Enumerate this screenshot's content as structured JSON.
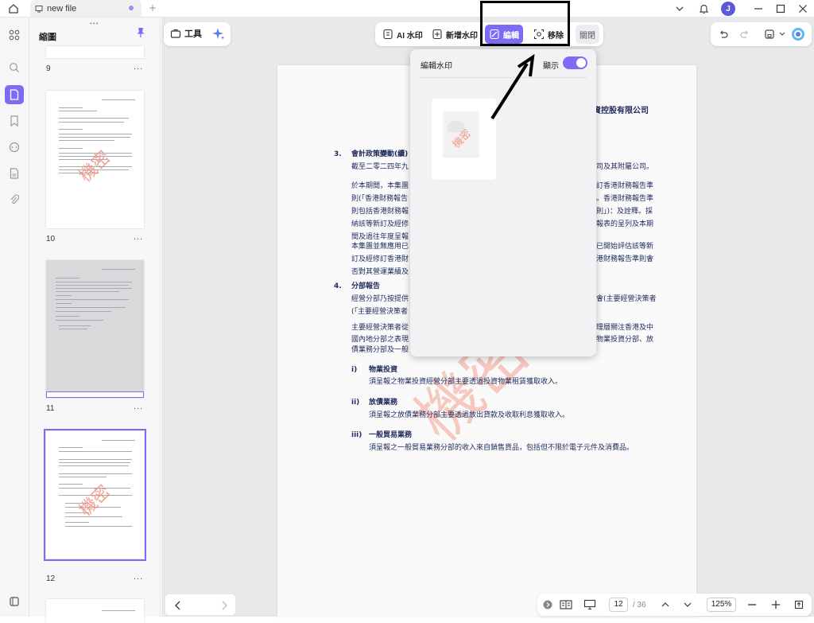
{
  "tab": {
    "title": "new file"
  },
  "user": {
    "initial": "J"
  },
  "panel": {
    "title": "縮圖"
  },
  "thumbs": [
    {
      "num": "9",
      "more": "..."
    },
    {
      "num": "10",
      "more": "...",
      "watermark": "機密"
    },
    {
      "num": "11",
      "more": "..."
    },
    {
      "num": "12",
      "more": "...",
      "watermark": "機密"
    }
  ],
  "toolbar": {
    "tools_label": "工具"
  },
  "watermark_bar": {
    "ai_label": "AI 水印",
    "add_label": "新增水印",
    "edit_label": "編輯",
    "remove_label": "移除",
    "close_label": "關閉"
  },
  "popup": {
    "title": "編輯水印",
    "show_label": "顯示",
    "show_on": true,
    "thumb_watermark": "機密"
  },
  "document": {
    "company": "投資控股有限公司",
    "s3_num": "3.",
    "s3_title": "會計政策變動(續)",
    "p1": "截至二零二四年九",
    "p1r": "司及其附屬公司。",
    "p2": [
      "於本期間，本集團",
      "則(「香港財務報告",
      "則包括香港財務報",
      "納該等新訂及經修",
      "間及過往年度呈報"
    ],
    "p2r": [
      "訂香港財務報告準",
      "。香港財務報告準",
      "則」)：及詮釋。採",
      "報表的呈列及本期"
    ],
    "p3": [
      "本集團並無應用已",
      "訂及經修訂香港財",
      "否對其營運業績及"
    ],
    "p3r": [
      "已開始評估該等新",
      "港財務報告準則會"
    ],
    "s4_num": "4.",
    "s4_title": "分部報告",
    "p4": [
      "經營分部乃按提供",
      "(「主要經營決策者"
    ],
    "p4r": [
      "會(主要經營決策者"
    ],
    "p5": [
      "主要經營決策者從",
      "國內地分部之表現",
      "債業務分部及一般"
    ],
    "p5r": [
      "理層關注香港及中",
      "物業投資分部、放"
    ],
    "i_num": "i)",
    "i_title": "物業投資",
    "i_text": "須呈報之物業投資經營分部主要透過投資物業租賃獲取收入。",
    "ii_num": "ii)",
    "ii_title": "放債業務",
    "ii_text": "須呈報之放債業務分部主要透過放出貸款及收取利息獲取收入。",
    "iii_num": "iii)",
    "iii_title": "一般貿易業務",
    "iii_text": "須呈報之一般貿易業務分部的收入來自銷售貨品，包括但不限於電子元件及消費品。",
    "watermark": "機密"
  },
  "pager": {
    "current": "12",
    "total": "/ 36",
    "zoom": "125%"
  },
  "colors": {
    "accent": "#7c6cf5",
    "watermark": "#f08a78",
    "doc_text": "#1f2a5c"
  }
}
